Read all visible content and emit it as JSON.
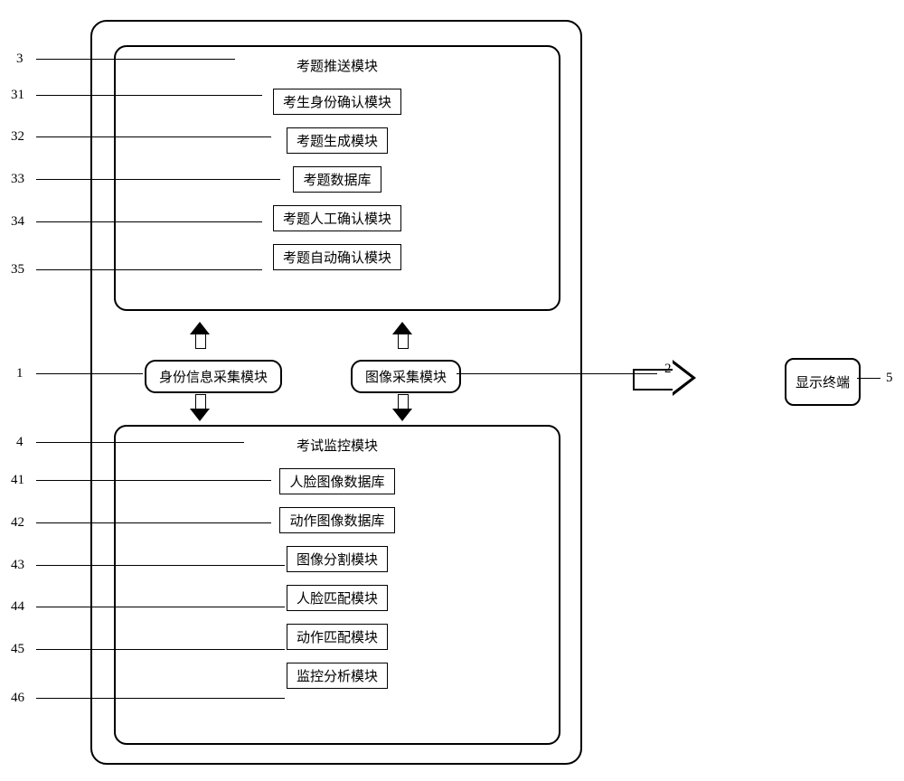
{
  "labels": {
    "n3": "3",
    "n31": "31",
    "n32": "32",
    "n33": "33",
    "n34": "34",
    "n35": "35",
    "n1": "1",
    "n2": "2",
    "n4": "4",
    "n41": "41",
    "n42": "42",
    "n43": "43",
    "n44": "44",
    "n45": "45",
    "n46": "46",
    "n5": "5"
  },
  "top_module": {
    "title": "考题推送模块",
    "items": [
      "考生身份确认模块",
      "考题生成模块",
      "考题数据库",
      "考题人工确认模块",
      "考题自动确认模块"
    ]
  },
  "middle": {
    "left": "身份信息采集模块",
    "right": "图像采集模块"
  },
  "bottom_module": {
    "title": "考试监控模块",
    "items": [
      "人脸图像数据库",
      "动作图像数据库",
      "图像分割模块",
      "人脸匹配模块",
      "动作匹配模块",
      "监控分析模块"
    ]
  },
  "terminal": "显示终端"
}
